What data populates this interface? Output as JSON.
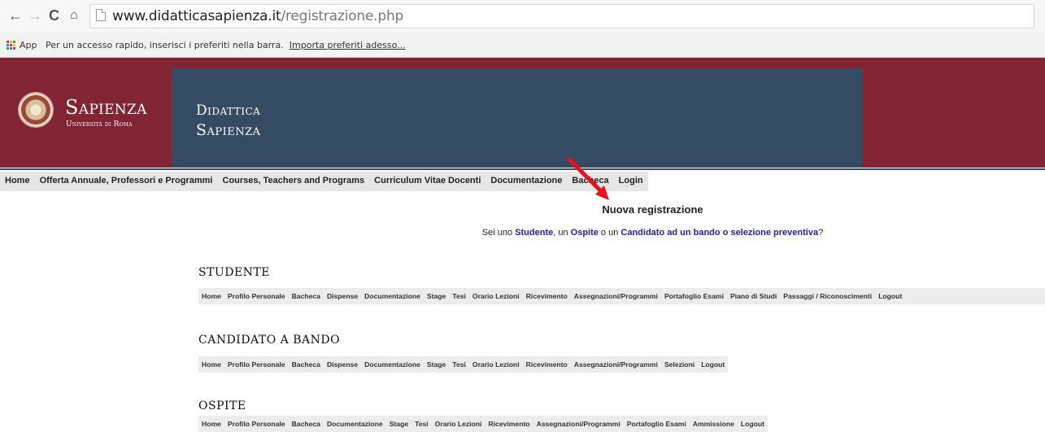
{
  "browser": {
    "url_host": "www.didatticasapienza.it",
    "url_path": "/registrazione.php",
    "bookmarks": {
      "app_label": "App",
      "hint": "Per un accesso rapido, inserisci i preferiti nella barra.",
      "import_link": "Importa preferiti adesso..."
    }
  },
  "header": {
    "logo_main": "Sapienza",
    "logo_sub": "Università di Roma",
    "title_line1": "Didattica",
    "title_line2": "Sapienza",
    "brand_color": "#822433",
    "panel_color": "#354a63"
  },
  "main_nav": [
    "Home",
    "Offerta Annuale, Professori e Programmi",
    "Courses, Teachers and Programs",
    "Curriculum Vitae Docenti",
    "Documentazione",
    "Bacheca",
    "Login"
  ],
  "registration": {
    "title": "Nuova registrazione",
    "q_prefix": "Sei uno ",
    "q_student": "Studente",
    "q_sep1": ", un ",
    "q_guest": "Ospite",
    "q_sep2": " o un ",
    "q_candidate": "Candidato ad un bando o selezione preventiva",
    "q_suffix": "?"
  },
  "sections": {
    "studente": {
      "title": "STUDENTE",
      "items": [
        "Home",
        "Profilo Personale",
        "Bacheca",
        "Dispense",
        "Documentazione",
        "Stage",
        "Tesi",
        "Orario Lezioni",
        "Ricevimento",
        "Assegnazioni/Programmi",
        "Portafoglio Esami",
        "Piano di Studi",
        "Passaggi / Riconoscimenti",
        "Logout"
      ]
    },
    "candidato": {
      "title": "CANDIDATO A BANDO",
      "items": [
        "Home",
        "Profilo Personale",
        "Bacheca",
        "Dispense",
        "Documentazione",
        "Stage",
        "Tesi",
        "Orario Lezioni",
        "Ricevimento",
        "Assegnazioni/Programmi",
        "Selezioni",
        "Logout"
      ]
    },
    "ospite": {
      "title": "OSPITE",
      "items": [
        "Home",
        "Profilo Personale",
        "Bacheca",
        "Documentazione",
        "Stage",
        "Tesi",
        "Orario Lezioni",
        "Ricevimento",
        "Assegnazioni/Programmi",
        "Portafoglio Esami",
        "Ammissione",
        "Logout"
      ]
    }
  }
}
